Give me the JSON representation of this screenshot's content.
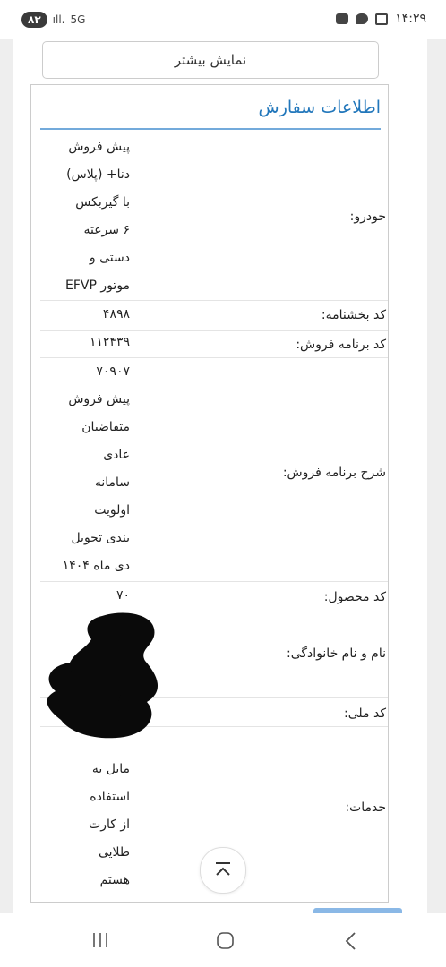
{
  "status_bar": {
    "time": "۱۴:۲۹",
    "battery": "۸۲",
    "network": "5G"
  },
  "show_more_label": "نمایش بیشتر",
  "order_info": {
    "title": "اطلاعات سفارش",
    "rows": [
      {
        "label": "خودرو:",
        "lines": [
          "پیش فروش",
          "دنا+ (پلاس)",
          "با گیربکس",
          "۶ سرعته",
          "دستی و",
          "موتور EFVP"
        ]
      },
      {
        "label": "کد بخشنامه:",
        "lines": [
          "۴۸۹۸"
        ]
      },
      {
        "label": "کد برنامه فروش:",
        "lines": [
          "۱۱۲۴۳۹"
        ]
      },
      {
        "label": "شرح برنامه فروش:",
        "lines": [
          "۷۰۹۰۷",
          "پیش فروش",
          "متقاضیان",
          "عادی",
          "سامانه",
          "اولویت",
          "بندی تحویل",
          "دی ماه ۱۴۰۴"
        ]
      },
      {
        "label": "کد محصول:",
        "lines": [
          "۷۰"
        ]
      },
      {
        "label": "نام و نام خانوادگی:",
        "lines": []
      },
      {
        "label": "کد ملی:",
        "lines": []
      },
      {
        "label": "خدمات:",
        "lines": [
          "مایل به",
          "استفاده",
          "از کارت",
          "طلایی",
          "هستم"
        ]
      }
    ]
  },
  "icons": {
    "scroll_top": "chevron-up-icon",
    "nav_recents": "recents-icon",
    "nav_home": "home-icon",
    "nav_back": "back-icon"
  },
  "colors": {
    "title": "#2277bb",
    "rule": "#5b9bd5",
    "button": "#8ab8e6"
  }
}
